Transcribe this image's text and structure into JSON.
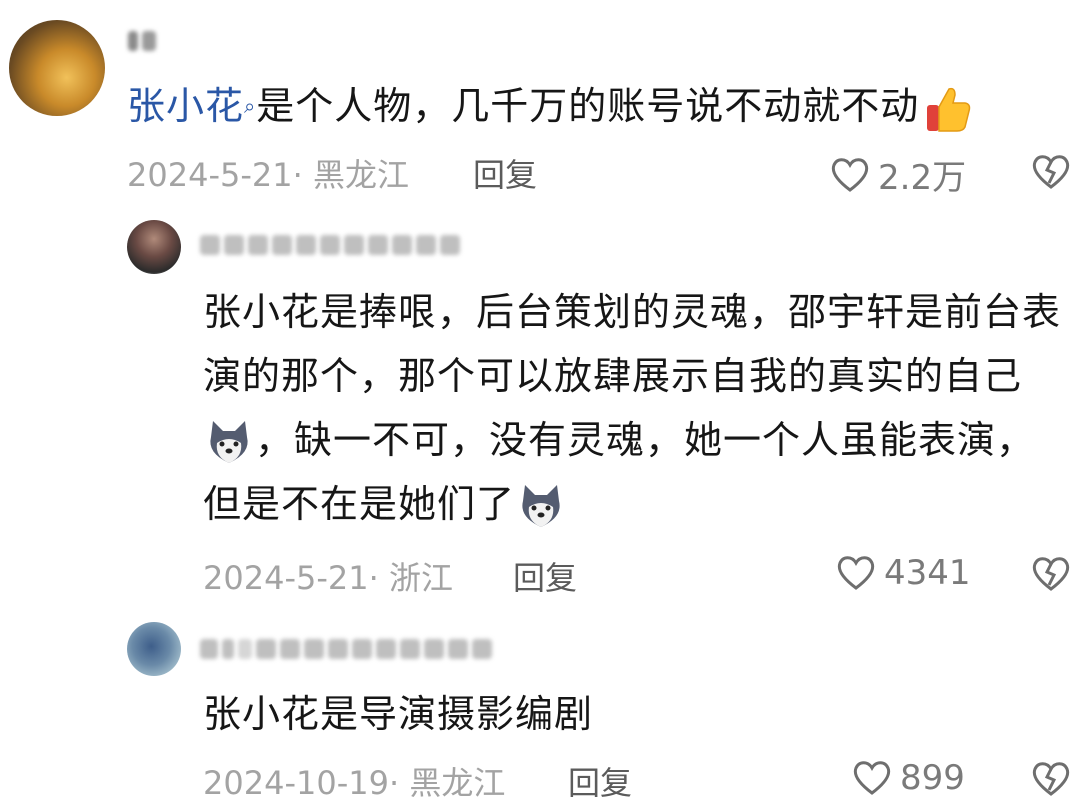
{
  "comments": [
    {
      "mention": "张小花",
      "text": "是个人物，几千万的账号说不动就不动",
      "date": "2024-5-21",
      "location": "黑龙江",
      "reply_label": "回复",
      "likes": "2.2万"
    },
    {
      "lines": [
        "张小花是捧哏，后台策划的灵魂，邵宇轩是前台表",
        "演的那个，那个可以放肆展示自我的真实的自己",
        "，缺一不可，没有灵魂，她一个人虽能表演，",
        "但是不在是她们了"
      ],
      "date": "2024-5-21",
      "location": "浙江",
      "reply_label": "回复",
      "likes": "4341"
    },
    {
      "text": "张小花是导演摄影编剧",
      "date": "2024-10-19",
      "location": "黑龙江",
      "reply_label": "回复",
      "likes": "899"
    }
  ],
  "colors": {
    "mention": "#2a57a6",
    "meta": "#a3a3a3",
    "icon": "#6e6e6e"
  }
}
